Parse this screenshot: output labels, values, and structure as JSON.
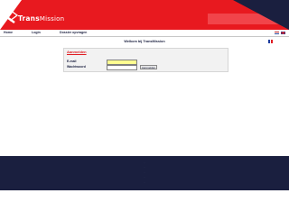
{
  "brand": {
    "logo_part1": "Trans",
    "logo_part2": "Mission"
  },
  "colors": {
    "brand_red": "#e8191f",
    "navy": "#1a1f3f",
    "input_highlight": "#fffe90"
  },
  "nav": {
    "items": [
      "Home",
      "Login",
      "Dossier opvragen"
    ],
    "languages": [
      "fr-flag-icon",
      "nl-flag-icon",
      "en-flag-icon"
    ]
  },
  "main": {
    "welcome": "Welkom bij TransMission"
  },
  "login": {
    "title": "Aanmelden",
    "email_label": "E-mail",
    "email_value": "",
    "password_label": "Wachtwoord",
    "password_value": "",
    "submit_label": "Aanmelden"
  }
}
